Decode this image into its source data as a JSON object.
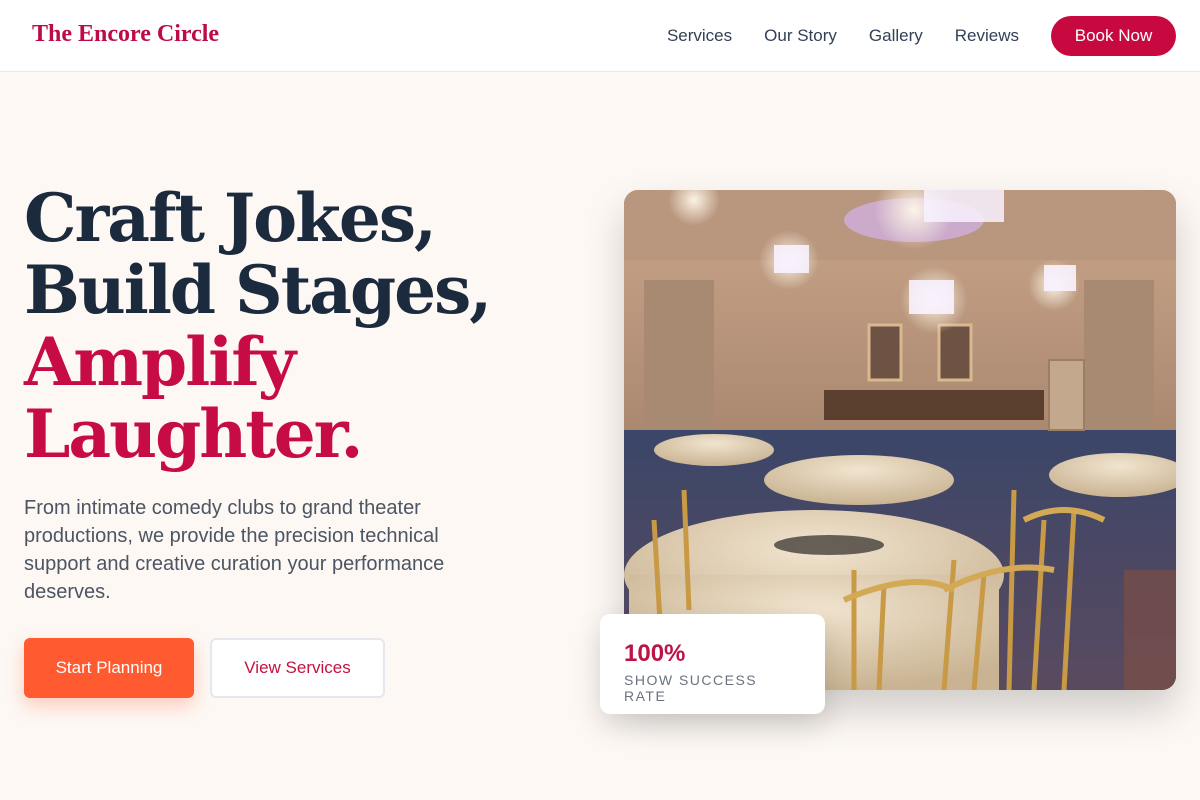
{
  "brand": {
    "name": "The Encore Circle",
    "color": "#be0b45"
  },
  "nav": {
    "items": [
      {
        "label": "Services"
      },
      {
        "label": "Our Story"
      },
      {
        "label": "Gallery"
      },
      {
        "label": "Reviews"
      }
    ],
    "cta_label": "Book Now"
  },
  "hero": {
    "headline": {
      "line1": "Craft Jokes,",
      "line2": "Build Stages,",
      "line3": "Amplify",
      "line4": "Laughter."
    },
    "description": "From intimate comedy clubs to grand theater productions, we provide the precision technical support and creative curation your performance deserves.",
    "primary_button": "Start Planning",
    "secondary_button": "View Services",
    "image_description": "banquet-hall-photo"
  },
  "stat": {
    "value": "100%",
    "label": "SHOW SUCCESS RATE"
  },
  "colors": {
    "accent": "#c70b43",
    "primary_button": "#ff5a30",
    "heading": "#1b2a3d",
    "background": "#fdf8f4"
  }
}
